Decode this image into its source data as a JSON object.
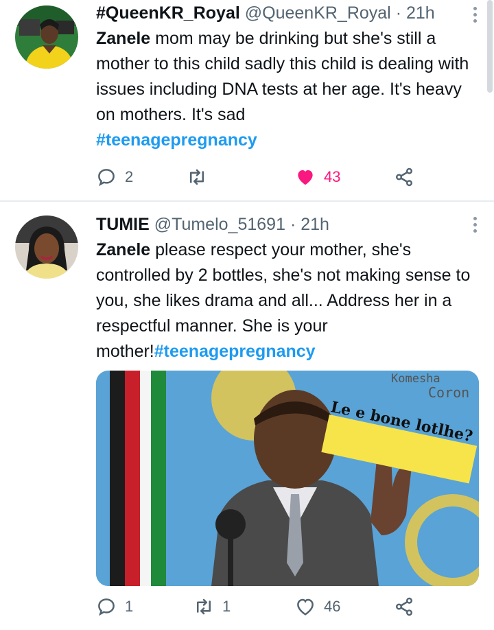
{
  "tweets": [
    {
      "name": "#QueenKR_Royal",
      "handle": "@QueenKR_Royal",
      "time": "· 21h",
      "mention": "Zanele",
      "text": " mom may be drinking but she's still a mother to this child sadly this child is dealing with issues including DNA tests at her age. It's heavy on mothers. It's sad",
      "hashtag": "#teenagepregnancy",
      "replies": "2",
      "retweets": "",
      "likes": "43",
      "liked": true
    },
    {
      "name": "TUMIE",
      "handle": "@Tumelo_51691",
      "time": "· 21h",
      "mention": "Zanele",
      "text": " please respect your mother, she's controlled by 2 bottles, she's not making sense to you, she likes drama and all... Address her in a respectful manner. She is your mother!",
      "hashtag": "#teenagepregnancy",
      "media": {
        "top_text_1": "Komesha",
        "top_text_2": "Coron",
        "sticker": "Le e bone lotlhe?"
      },
      "replies": "1",
      "retweets": "1",
      "likes": "46",
      "liked": false
    }
  ],
  "icons": {
    "reply": "reply-icon",
    "retweet": "retweet-icon",
    "like": "heart-icon",
    "share": "share-icon",
    "more": "more-icon"
  },
  "colors": {
    "accent": "#1d9bf0",
    "like": "#f91880",
    "muted": "#536471"
  }
}
